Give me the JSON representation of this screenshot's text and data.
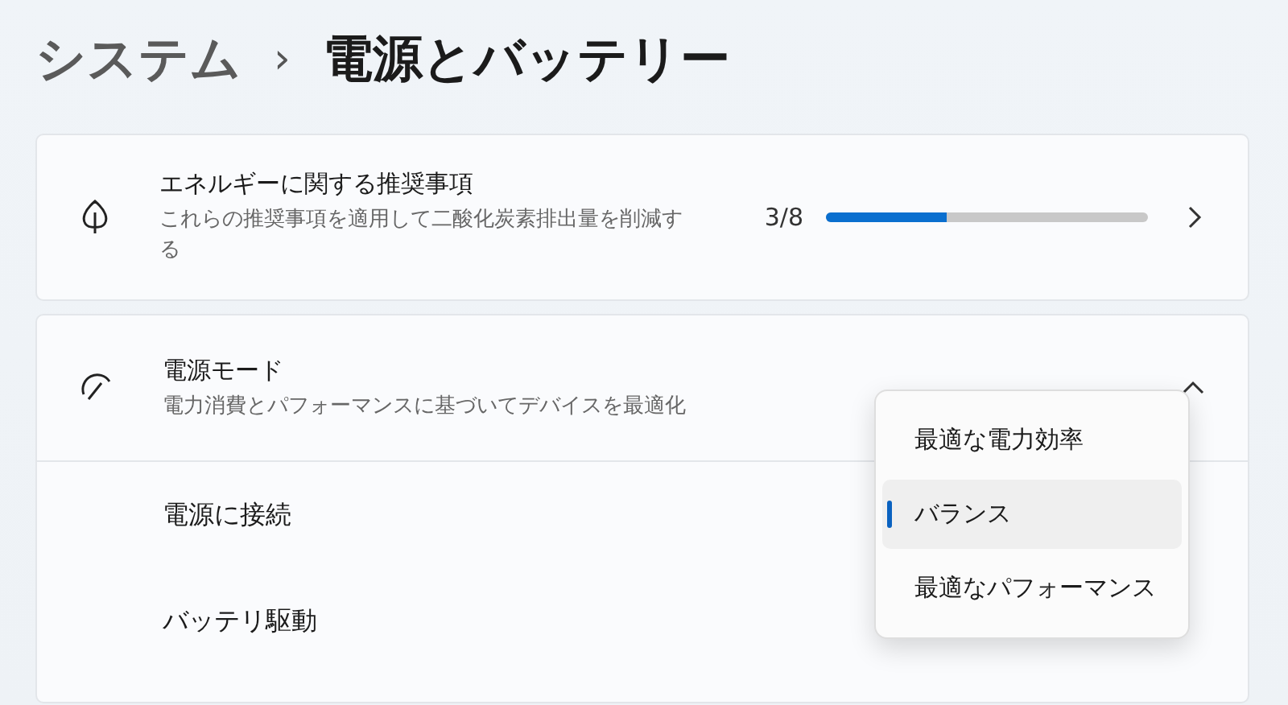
{
  "breadcrumb": {
    "parent": "システム",
    "separator": "›",
    "current": "電源とバッテリー"
  },
  "recommendations": {
    "title": "エネルギーに関する推奨事項",
    "description": "これらの推奨事項を適用して二酸化炭素排出量を削減する",
    "count": "3/8",
    "level": 0.375
  },
  "power_mode": {
    "title": "電源モード",
    "description": "電力消費とパフォーマンスに基づいてデバイスを最適化",
    "expanded": true,
    "rows": [
      {
        "label": "電源に接続"
      },
      {
        "label": "バッテリ駆動"
      }
    ],
    "menu": [
      {
        "label": "最適な電力効率",
        "selected": false
      },
      {
        "label": "バランス",
        "selected": true
      },
      {
        "label": "最適なパフォーマンス",
        "selected": false
      }
    ]
  }
}
